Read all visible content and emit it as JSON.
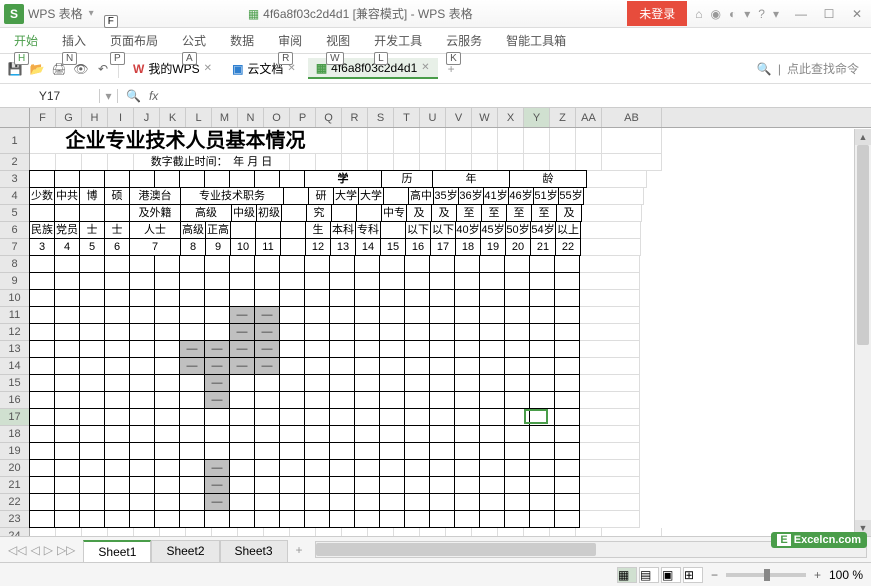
{
  "title_bar": {
    "logo": "S",
    "app_name": "WPS 表格",
    "key_f": "F",
    "doc_title": "4f6a8f03c2d4d1 [兼容模式] - WPS 表格",
    "login": "未登录",
    "icons": {
      "home": "⌂",
      "globe": "◉",
      "theme": "◐",
      "help": "?",
      "down": "▾"
    },
    "win": {
      "min": "—",
      "max": "☐",
      "close": "✕"
    }
  },
  "menu": {
    "items": [
      "开始",
      "插入",
      "页面布局",
      "公式",
      "数据",
      "审阅",
      "视图",
      "开发工具",
      "云服务",
      "智能工具箱"
    ],
    "hints": [
      "H",
      "N",
      "P",
      "A",
      "-",
      "R",
      "W",
      "L",
      "K",
      ""
    ]
  },
  "toolbar": {
    "tabs": [
      {
        "icon": "W",
        "label": "我的WPS",
        "color": "#d04040"
      },
      {
        "icon": "▣",
        "label": "云文档",
        "color": "#3080d0"
      },
      {
        "icon": "▦",
        "label": "4f6a8f03c2d4d1",
        "color": "#4a9d4a"
      }
    ],
    "add": "+",
    "search_icon": "🔍",
    "sep": "|",
    "search_placeholder": "点此查找命令"
  },
  "formula_bar": {
    "name_box": "Y17",
    "down": "▾",
    "search": "🔍",
    "fx": "fx"
  },
  "grid": {
    "cols": [
      "F",
      "G",
      "H",
      "I",
      "J",
      "K",
      "L",
      "M",
      "N",
      "O",
      "P",
      "Q",
      "R",
      "S",
      "T",
      "U",
      "V",
      "W",
      "X",
      "Y",
      "Z",
      "AA",
      "AB"
    ],
    "widths": [
      26,
      26,
      26,
      26,
      26,
      26,
      26,
      26,
      26,
      26,
      26,
      26,
      26,
      26,
      26,
      26,
      26,
      26,
      26,
      26,
      26,
      26,
      60
    ],
    "active_col_idx": 19,
    "row_count": 24,
    "active_row": 17,
    "title": "企业专业技术人员基本情况",
    "subtitle": "数字截止时间：　年 月 日",
    "merges": {
      "xue": "学",
      "li": "历",
      "nian": "年",
      "ling": "龄"
    },
    "row4": {
      "f": "少数",
      "g": "中共",
      "h": "博",
      "i": "硕",
      "j": "港澳台",
      "l_o": "专业技术职务",
      "p": "",
      "q": "研",
      "r": "大学",
      "s": "大学",
      "t": "",
      "u": "高中",
      "v": "35岁",
      "w": "36岁",
      "x": "41岁",
      "y": "46岁",
      "z": "51岁",
      "aa": "55岁"
    },
    "row5": {
      "j": "及外籍",
      "l": "高级",
      "n": "中级",
      "o": "初级",
      "q": "究",
      "t": "中专",
      "u": "及",
      "v": "及",
      "w": "至",
      "x": "至",
      "y": "至",
      "z": "至",
      "aa": "及"
    },
    "row6": {
      "f": "民族",
      "g": "党员",
      "h": "士",
      "i": "士",
      "j": "人士",
      "l": "高级",
      "m": "正高",
      "q": "生",
      "r": "本科",
      "s": "专科",
      "u": "以下",
      "v": "以下",
      "w": "40岁",
      "x": "45岁",
      "y": "50岁",
      "z": "54岁",
      "aa": "以上"
    },
    "row7": [
      "3",
      "4",
      "5",
      "6",
      "7",
      "",
      "8",
      "9",
      "10",
      "11",
      "12",
      "13",
      "14",
      "15",
      "16",
      "17",
      "18",
      "19",
      "20",
      "21",
      "22"
    ]
  },
  "sheets": {
    "nav": [
      "◁◁",
      "◁",
      "▷",
      "▷▷"
    ],
    "tabs": [
      "Sheet1",
      "Sheet2",
      "Sheet3"
    ],
    "add": "+"
  },
  "status": {
    "views": [
      "▦",
      "▤",
      "▣",
      "⊞"
    ],
    "zoom_out": "−",
    "zoom_in": "+",
    "zoom": "100 %"
  },
  "watermark": {
    "e": "E",
    "text": "Excelcn.com"
  }
}
